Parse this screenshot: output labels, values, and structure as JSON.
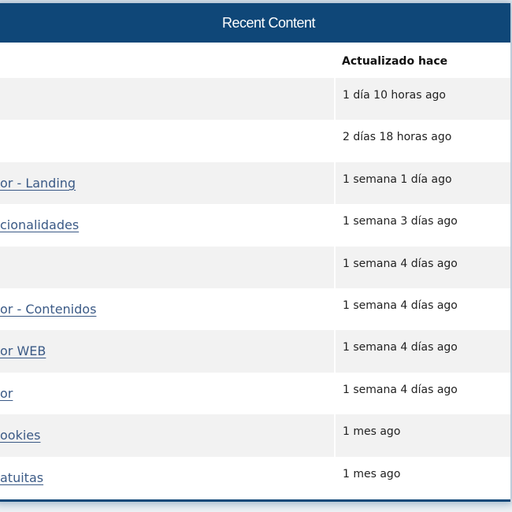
{
  "panel": {
    "title": "Recent Content"
  },
  "table": {
    "columns": {
      "title": "",
      "updated": "Actualizado hace"
    },
    "rows": [
      {
        "title": "",
        "updated": "1 día 10 horas ago"
      },
      {
        "title": "",
        "updated": "2 días 18 horas ago"
      },
      {
        "title": "or - Landing",
        "updated": "1 semana 1 día ago"
      },
      {
        "title": "cionalidades",
        "updated": "1 semana 3 días ago"
      },
      {
        "title": "",
        "updated": "1 semana 4 días ago"
      },
      {
        "title": "or - Contenidos",
        "updated": "1 semana 4 días ago"
      },
      {
        "title": "or WEB",
        "updated": "1 semana 4 días ago"
      },
      {
        "title": "or",
        "updated": "1 semana 4 días ago"
      },
      {
        "title": "ookies",
        "updated": "1 mes ago"
      },
      {
        "title": "atuitas",
        "updated": "1 mes ago"
      }
    ]
  },
  "colors": {
    "header_bg": "#0f4778",
    "link": "#3b5a86",
    "row_alt": "#f2f2f2"
  }
}
